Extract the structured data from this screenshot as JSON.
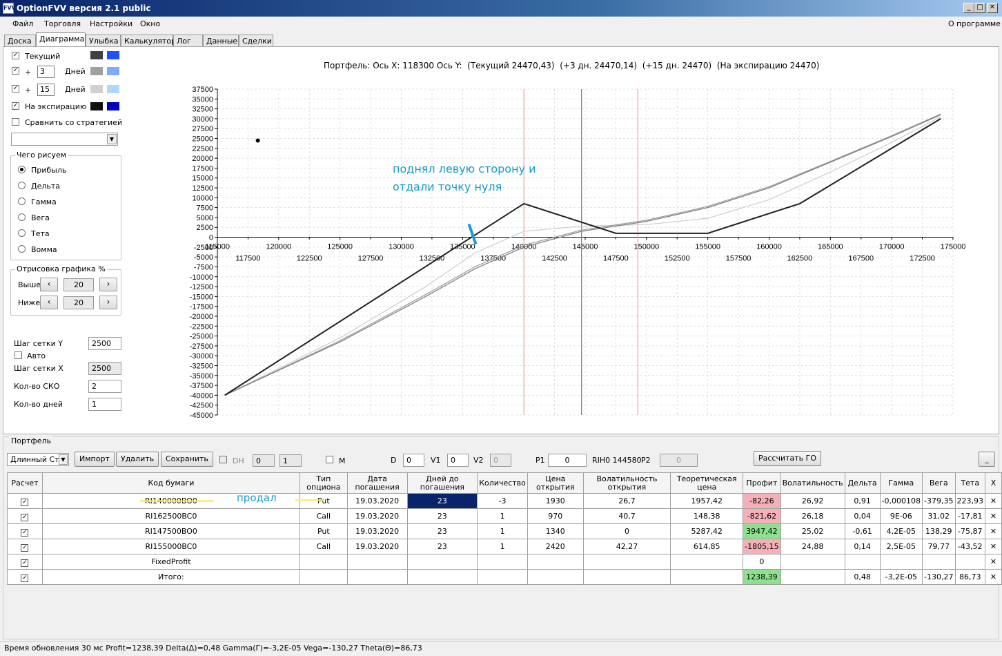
{
  "window": {
    "title": "OptionFVV версия 2.1 public",
    "icon": "app-icon"
  },
  "menu": {
    "items": [
      "Файл",
      "Торговля",
      "Настройки",
      "Окно"
    ],
    "about": "О программе"
  },
  "tabs": [
    "Доска",
    "Диаграмма",
    "Улыбка",
    "Калькулятор",
    "Лог",
    "Данные",
    "Сделки"
  ],
  "left": {
    "current": "Текущий",
    "plus": "+",
    "days_label": "Дней",
    "days1": "3",
    "days2": "15",
    "expiry": "На экспирацию",
    "compare": "Сравнить со стратегией",
    "draw_group": "Чего рисуем",
    "radios": [
      "Прибыль",
      "Дельта",
      "Гамма",
      "Вега",
      "Тета",
      "Вомма"
    ],
    "render_group": "Отрисовка графика %",
    "above": "Выше",
    "below": "Ниже",
    "above_val": "20",
    "below_val": "20",
    "grid_y_label": "Шаг сетки Y",
    "grid_y": "2500",
    "auto": "Авто",
    "grid_x_label": "Шаг сетки X",
    "grid_x": "2500",
    "sko_label": "Кол-во СКО",
    "sko": "2",
    "days_count_label": "Кол-во дней",
    "days_count": "1",
    "colors": {
      "current": [
        "#404040",
        "#2050ff"
      ],
      "d3": [
        "#a0a0a0",
        "#80aaff"
      ],
      "d15": [
        "#d0d0d0",
        "#b0d8ff"
      ],
      "exp": [
        "#101010",
        "#0000c0"
      ]
    }
  },
  "chart_data": {
    "type": "line",
    "title": "Портфель: Ось X: 118300 Ось Y:  (Текущий 24470,43)  (+3 дн. 24470,14)  (+15 дн. 24470)  (На экспирацию 24470)",
    "xlim": [
      115000,
      175000
    ],
    "ylim": [
      -45000,
      37500
    ],
    "x_ticks_upper": [
      "115000",
      "120000",
      "125000",
      "130000",
      "135000",
      "140000",
      "145000",
      "150000",
      "155000",
      "160000",
      "165000",
      "170000",
      "175000"
    ],
    "x_ticks_lower": [
      "117500",
      "122500",
      "127500",
      "132500",
      "137500",
      "142500",
      "147500",
      "152500",
      "157500",
      "162500",
      "167500",
      "172500"
    ],
    "y_ticks": [
      "37500",
      "35000",
      "32500",
      "30000",
      "27500",
      "25000",
      "22500",
      "20000",
      "17500",
      "15000",
      "12500",
      "10000",
      "7500",
      "5000",
      "2500",
      "0",
      "-2500",
      "-5000",
      "-7500",
      "-10000",
      "-12500",
      "-15000",
      "-17500",
      "-20000",
      "-22500",
      "-25000",
      "-27500",
      "-30000",
      "-32500",
      "-35000",
      "-37500",
      "-40000",
      "-42500",
      "-45000"
    ],
    "vlines": [
      {
        "x": 140000,
        "color": "#f0a0a0"
      },
      {
        "x": 144700,
        "color": "#6080b0"
      },
      {
        "x": 149300,
        "color": "#f0a0a0"
      }
    ],
    "cursor_point": {
      "x": 118300,
      "y": 24470
    },
    "series": [
      {
        "color": "#202020",
        "points": [
          [
            115600,
            -40000
          ],
          [
            140000,
            8500
          ],
          [
            147500,
            1000
          ],
          [
            155000,
            1000
          ],
          [
            162500,
            8500
          ],
          [
            174000,
            30000
          ]
        ]
      },
      {
        "color": "#808080",
        "points": [
          [
            115600,
            -40000
          ],
          [
            125000,
            -26500
          ],
          [
            132000,
            -15000
          ],
          [
            136000,
            -8000
          ],
          [
            140000,
            -2500
          ],
          [
            144700,
            1500
          ],
          [
            150000,
            4000
          ],
          [
            155000,
            7500
          ],
          [
            160000,
            12500
          ],
          [
            165000,
            19000
          ],
          [
            170000,
            25500
          ],
          [
            174000,
            31000
          ]
        ]
      },
      {
        "color": "#a0a0a0",
        "points": [
          [
            115600,
            -40000
          ],
          [
            125000,
            -26200
          ],
          [
            132000,
            -14500
          ],
          [
            136000,
            -7500
          ],
          [
            140000,
            -2000
          ],
          [
            144700,
            1800
          ],
          [
            150000,
            4300
          ],
          [
            155000,
            7800
          ],
          [
            160000,
            12800
          ],
          [
            165000,
            19200
          ],
          [
            170000,
            25700
          ],
          [
            174000,
            31200
          ]
        ]
      },
      {
        "color": "#d0d0d0",
        "points": [
          [
            115600,
            -40000
          ],
          [
            125000,
            -25500
          ],
          [
            132000,
            -12500
          ],
          [
            136000,
            -4000
          ],
          [
            140000,
            1500
          ],
          [
            144700,
            2800
          ],
          [
            150000,
            3200
          ],
          [
            155000,
            4800
          ],
          [
            160000,
            9500
          ],
          [
            165000,
            16500
          ],
          [
            170000,
            24000
          ],
          [
            174000,
            30500
          ]
        ]
      }
    ]
  },
  "annotation": {
    "line1": "поднял левую сторону и",
    "line2": "отдали точку нуля",
    "sold": "продал"
  },
  "portfolio": {
    "group": "Портфель",
    "combo": "Длинный Стр",
    "buttons": {
      "import": "Импорт",
      "delete": "Удалить",
      "save": "Сохранить",
      "go": "Рассчитать ГО",
      "minimize": "_"
    },
    "dh": "DH",
    "dh_v1": "0",
    "dh_v2": "1",
    "m": "M",
    "d_label": "D",
    "d": "0",
    "v1_label": "V1",
    "v1": "0",
    "v2_label": "V2",
    "v2": "0",
    "p1_label": "P1",
    "p1": "0",
    "ticker": "RIH0 144580",
    "p2_label": "P2",
    "p2": "0"
  },
  "table": {
    "headers": [
      "Расчет",
      "Код бумаги",
      "Тип опциона",
      "Дата погашения",
      "Дней до погашения",
      "Количество",
      "Цена открытия",
      "Волатильность открытия",
      "Теоретическая цена",
      "Профит",
      "Волатильность",
      "Дельта",
      "Гамма",
      "Вега",
      "Тета",
      "X"
    ],
    "rows": [
      {
        "code": "RI140000BO0",
        "type": "Put",
        "date": "19.03.2020",
        "days": "23",
        "qty": "-3",
        "price": "1930",
        "vol_open": "26,7",
        "theo": "1957,42",
        "profit": "-82,26",
        "vol": "26,92",
        "delta": "0,91",
        "gamma": "-0,000108",
        "vega": "-379,35",
        "theta": "223,93",
        "pc": "red",
        "sel": true
      },
      {
        "code": "RI162500BC0",
        "type": "Call",
        "date": "19.03.2020",
        "days": "23",
        "qty": "1",
        "price": "970",
        "vol_open": "40,7",
        "theo": "148,38",
        "profit": "-821,62",
        "vol": "26,18",
        "delta": "0,04",
        "gamma": "9E-06",
        "vega": "31,02",
        "theta": "-17,81",
        "pc": "red"
      },
      {
        "code": "RI147500BO0",
        "type": "Put",
        "date": "19.03.2020",
        "days": "23",
        "qty": "1",
        "price": "1340",
        "vol_open": "0",
        "theo": "5287,42",
        "profit": "3947,42",
        "vol": "25,02",
        "delta": "-0,61",
        "gamma": "4,2E-05",
        "vega": "138,29",
        "theta": "-75,87",
        "pc": "grn"
      },
      {
        "code": "RI155000BC0",
        "type": "Call",
        "date": "19.03.2020",
        "days": "23",
        "qty": "1",
        "price": "2420",
        "vol_open": "42,27",
        "theo": "614,85",
        "profit": "-1805,15",
        "vol": "24,88",
        "delta": "0,14",
        "gamma": "2,5E-05",
        "vega": "79,77",
        "theta": "-43,52",
        "pc": "red"
      },
      {
        "code": "FixedProfit",
        "type": "",
        "date": "",
        "days": "",
        "qty": "",
        "price": "",
        "vol_open": "",
        "theo": "",
        "profit": "0",
        "vol": "",
        "delta": "",
        "gamma": "",
        "vega": "",
        "theta": "",
        "pc": ""
      },
      {
        "code": "Итого:",
        "type": "",
        "date": "",
        "days": "",
        "qty": "",
        "price": "",
        "vol_open": "",
        "theo": "",
        "profit": "1238,39",
        "vol": "",
        "delta": "0,48",
        "gamma": "-3,2E-05",
        "vega": "-130,27",
        "theta": "86,73",
        "pc": "grn"
      }
    ]
  },
  "status": "Время обновления 30 мс  Profit=1238,39 Delta(Δ)=0,48 Gamma(Γ)=-3,2E-05 Vega=-130,27 Theta(Θ)=86,73"
}
